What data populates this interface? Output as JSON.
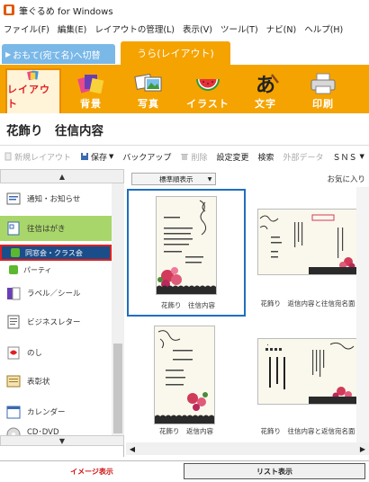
{
  "window": {
    "title": "筆ぐるめ for Windows"
  },
  "menu": [
    "ファイル(F)",
    "編集(E)",
    "レイアウトの管理(L)",
    "表示(V)",
    "ツール(T)",
    "ナビ(N)",
    "ヘルプ(H)"
  ],
  "mode_tabs": {
    "omote": "おもて(宛て名)へ切替",
    "ura": "うら(レイアウト)"
  },
  "categories": [
    {
      "label": "レイアウト",
      "icon": "layout-icon"
    },
    {
      "label": "背景",
      "icon": "background-icon"
    },
    {
      "label": "写真",
      "icon": "photo-icon"
    },
    {
      "label": "イラスト",
      "icon": "illustration-icon"
    },
    {
      "label": "文字",
      "icon": "text-icon"
    },
    {
      "label": "印刷",
      "icon": "printer-icon"
    }
  ],
  "section_title": "花飾り　往信内容",
  "actions": {
    "new": "新規レイアウト",
    "save": "保存",
    "backup": "バックアップ",
    "delete": "削除",
    "settings": "設定変更",
    "search": "検索",
    "external": "外部データ",
    "sns": "ＳＮＳ"
  },
  "sidebar": {
    "items": [
      {
        "label": "通知・お知らせ"
      },
      {
        "label": "往信はがき"
      },
      {
        "label": "ラベル／シール"
      },
      {
        "label": "ビジネスレター"
      },
      {
        "label": "のし"
      },
      {
        "label": "表彰状"
      },
      {
        "label": "カレンダー"
      },
      {
        "label": "CD･DVD"
      }
    ],
    "subitems": [
      {
        "label": "同窓会・クラス会"
      },
      {
        "label": "パーティ"
      }
    ]
  },
  "sort": {
    "value": "標準順表示"
  },
  "favorites": "お気に入り",
  "thumbnails": [
    {
      "caption": "花飾り　往信内容"
    },
    {
      "caption": "花飾り　返信内容と往信宛名面"
    },
    {
      "caption": "花飾り　返信内容"
    },
    {
      "caption": "花飾り　往信内容と返信宛名面"
    }
  ],
  "bottom_tabs": {
    "image": "イメージ表示",
    "list": "リスト表示"
  },
  "colors": {
    "accent": "#f5a300",
    "selected_blue": "#1f6fbf",
    "active_green": "#a9d66a",
    "highlight_red": "#e02020"
  }
}
